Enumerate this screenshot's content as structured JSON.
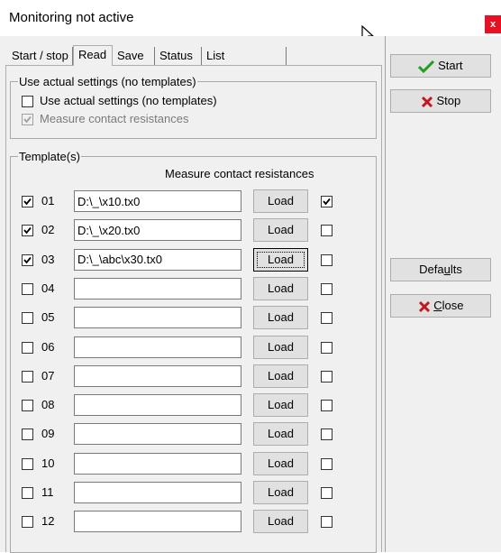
{
  "window": {
    "title": "Monitoring not active",
    "close_glyph": "x"
  },
  "tabs": [
    {
      "label": "Start / stop",
      "active": false
    },
    {
      "label": "Read",
      "active": true
    },
    {
      "label": "Save",
      "active": false
    },
    {
      "label": "Status",
      "active": false
    },
    {
      "label": "List",
      "active": false
    }
  ],
  "actual_settings": {
    "legend": "Use actual settings (no templates)",
    "use_actual": {
      "label": "Use actual settings (no templates)",
      "checked": false
    },
    "measure_contact": {
      "label": "Measure contact resistances",
      "checked": true,
      "disabled": true
    }
  },
  "templates": {
    "legend": "Template(s)",
    "column_header": "Measure contact resistances",
    "load_label": "Load",
    "rows": [
      {
        "num": "01",
        "enabled": true,
        "path": "D:\\_\\x10.tx0",
        "measure": true
      },
      {
        "num": "02",
        "enabled": true,
        "path": "D:\\_\\x20.tx0",
        "measure": false
      },
      {
        "num": "03",
        "enabled": true,
        "path": "D:\\_\\abc\\x30.tx0",
        "measure": false
      },
      {
        "num": "04",
        "enabled": false,
        "path": "",
        "measure": false
      },
      {
        "num": "05",
        "enabled": false,
        "path": "",
        "measure": false
      },
      {
        "num": "06",
        "enabled": false,
        "path": "",
        "measure": false
      },
      {
        "num": "07",
        "enabled": false,
        "path": "",
        "measure": false
      },
      {
        "num": "08",
        "enabled": false,
        "path": "",
        "measure": false
      },
      {
        "num": "09",
        "enabled": false,
        "path": "",
        "measure": false
      },
      {
        "num": "10",
        "enabled": false,
        "path": "",
        "measure": false
      },
      {
        "num": "11",
        "enabled": false,
        "path": "",
        "measure": false
      },
      {
        "num": "12",
        "enabled": false,
        "path": "",
        "measure": false
      }
    ]
  },
  "side_buttons": {
    "start": {
      "label": "Start",
      "icon": "green-check-icon"
    },
    "stop": {
      "label": "Stop",
      "icon": "red-x-icon"
    },
    "defaults": {
      "label_pre": "Defa",
      "label_mnemonic": "u",
      "label_post": "lts"
    },
    "close": {
      "label_mnemonic": "C",
      "label_post": "lose",
      "icon": "red-x-icon"
    }
  },
  "colors": {
    "check_green": "#1fa01f",
    "x_red": "#c8141e",
    "close_red": "#e81123"
  }
}
